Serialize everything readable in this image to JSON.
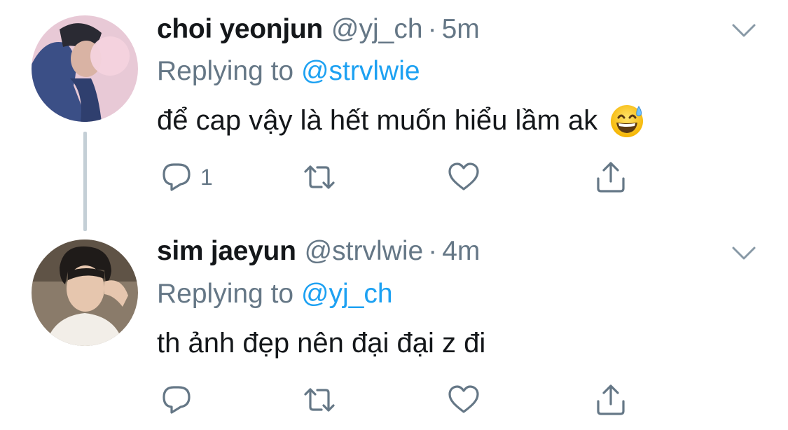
{
  "tweets": [
    {
      "display_name": "choi yeonjun",
      "handle": "@yj_ch",
      "separator": "·",
      "time": "5m",
      "replying_prefix": "Replying to",
      "replying_handle": "@strvlwie",
      "text": "để cap vậy là hết muốn hiểu lầm ak",
      "emoji": "grinning-face-with-sweat",
      "reply_count": "1"
    },
    {
      "display_name": "sim jaeyun",
      "handle": "@strvlwie",
      "separator": "·",
      "time": "4m",
      "replying_prefix": "Replying to",
      "replying_handle": "@yj_ch",
      "text": "th ảnh đẹp nên đại đại z đi",
      "reply_count": ""
    }
  ],
  "colors": {
    "text": "#14171a",
    "secondary": "#657786",
    "link": "#1da1f2",
    "thread_line": "#c4cfd6"
  },
  "icons": [
    "reply-icon",
    "retweet-icon",
    "like-icon",
    "share-icon",
    "chevron-down-icon"
  ]
}
